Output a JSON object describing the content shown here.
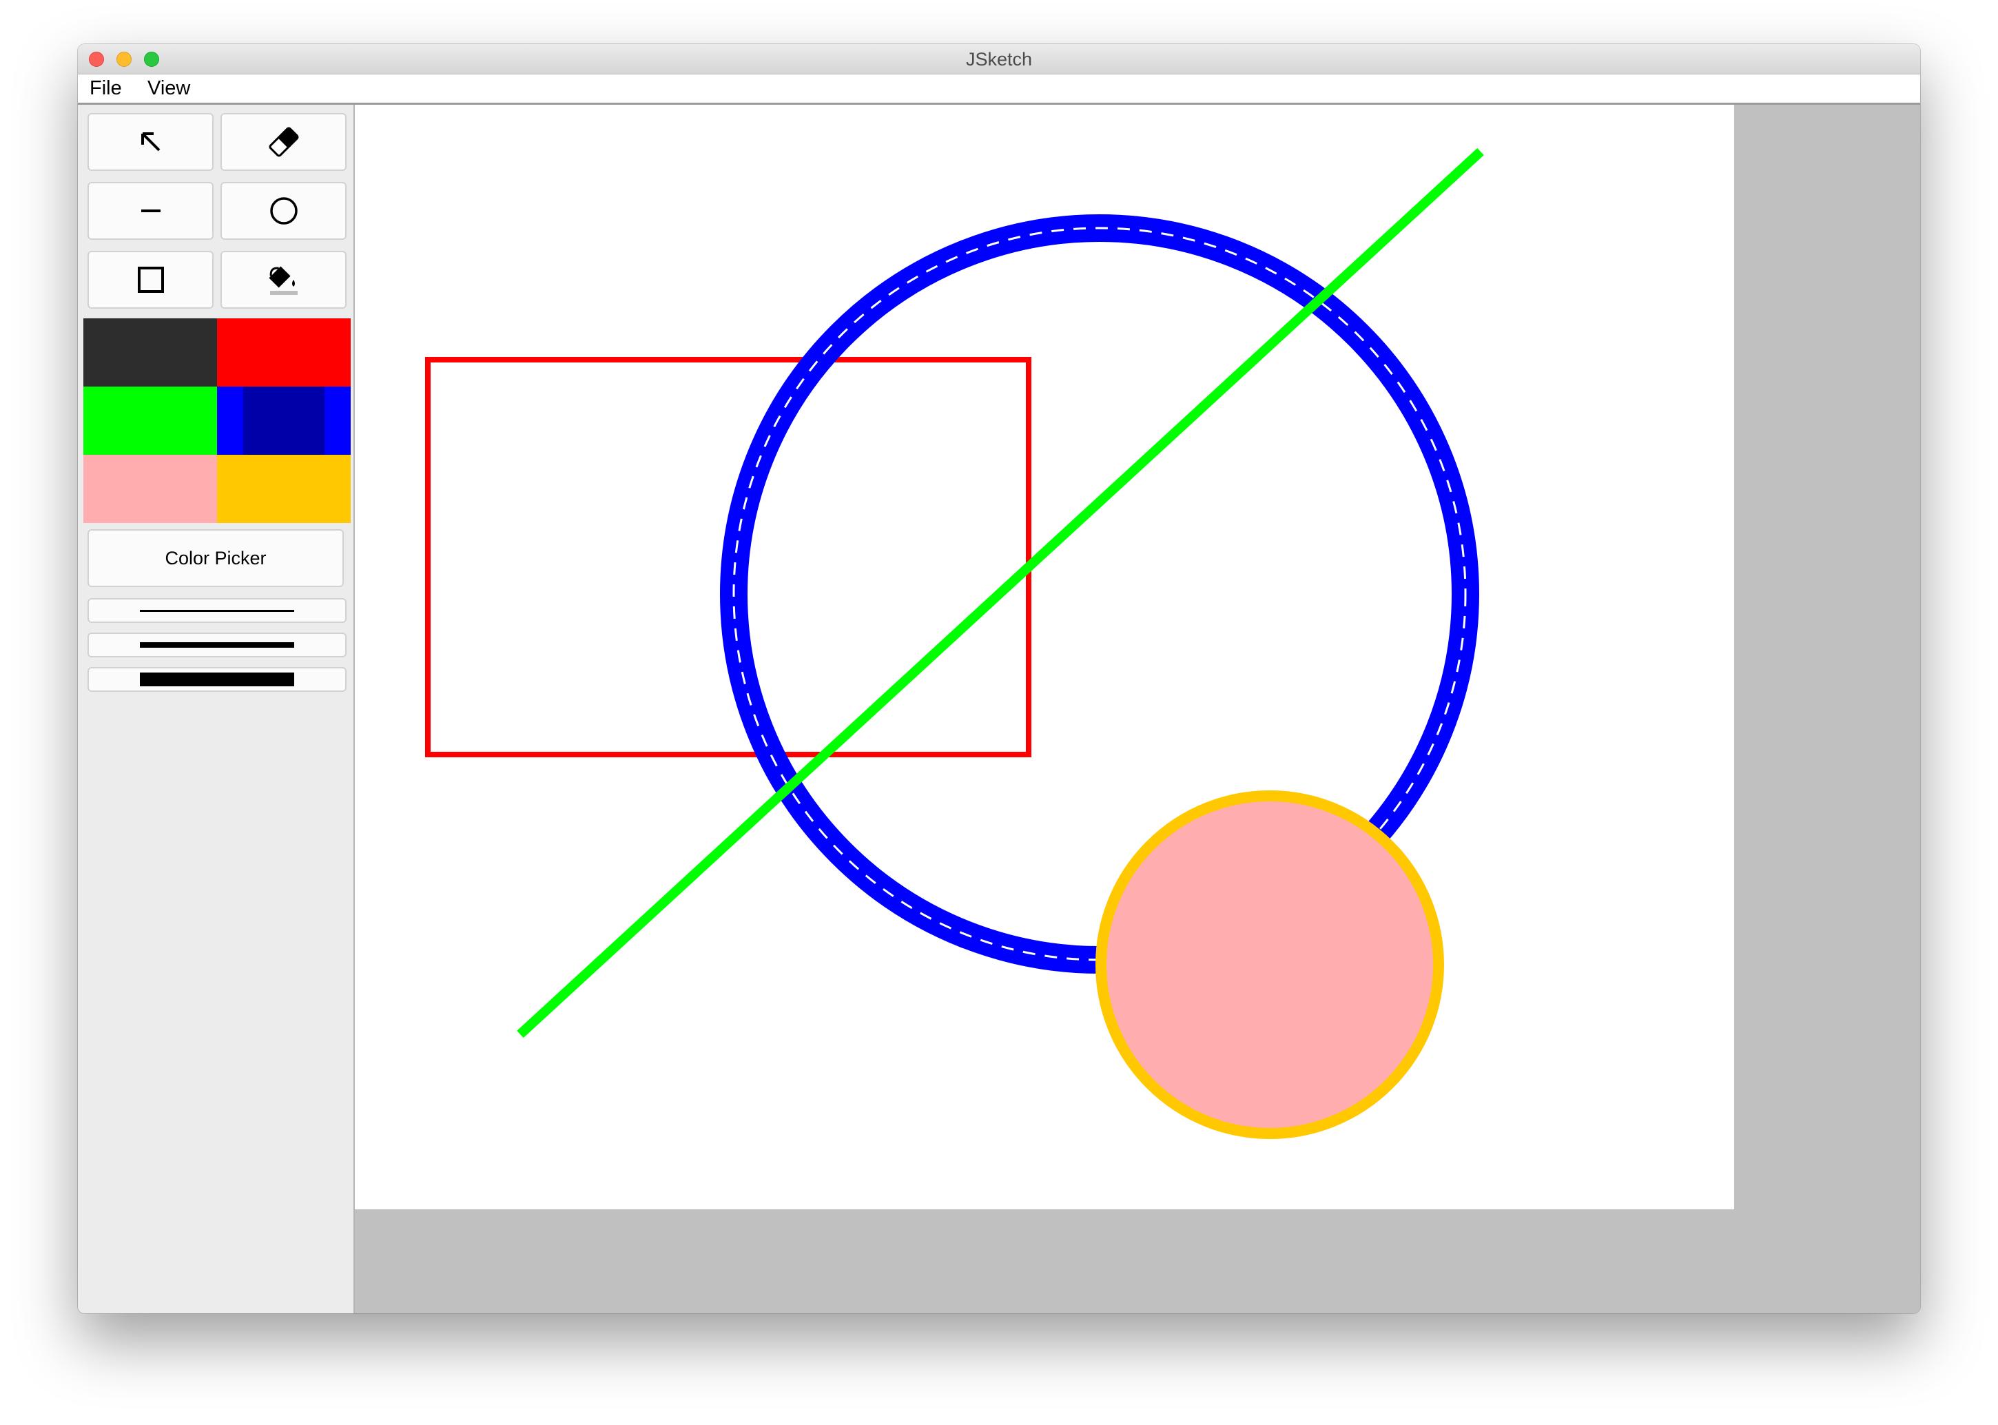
{
  "window": {
    "title": "JSketch"
  },
  "menu": {
    "items": [
      "File",
      "View"
    ]
  },
  "toolbar": {
    "tools": [
      {
        "name": "select",
        "icon": "select-arrow-icon"
      },
      {
        "name": "erase",
        "icon": "eraser-icon"
      },
      {
        "name": "line",
        "icon": "line-icon"
      },
      {
        "name": "circle",
        "icon": "circle-icon"
      },
      {
        "name": "rectangle",
        "icon": "rectangle-icon"
      },
      {
        "name": "fill",
        "icon": "paint-bucket-icon"
      }
    ],
    "palette": [
      "#2d2d2d",
      "#ff0000",
      "#00ff00",
      "#0000ff",
      "#ffadae",
      "#ffc800"
    ],
    "selected_color": "#0000ff",
    "color_picker_label": "Color Picker",
    "line_widths": [
      "thin",
      "medium",
      "thick"
    ]
  },
  "canvas": {
    "background": "#ffffff",
    "surround": "#c0c0c0",
    "shapes": [
      {
        "type": "rectangle",
        "stroke": "#ff0000",
        "fill": "none"
      },
      {
        "type": "circle",
        "stroke": "#0000ff",
        "fill": "none",
        "selected": true
      },
      {
        "type": "line",
        "stroke": "#00ff00"
      },
      {
        "type": "circle",
        "stroke": "#ffc800",
        "fill": "#ffadae"
      }
    ]
  }
}
